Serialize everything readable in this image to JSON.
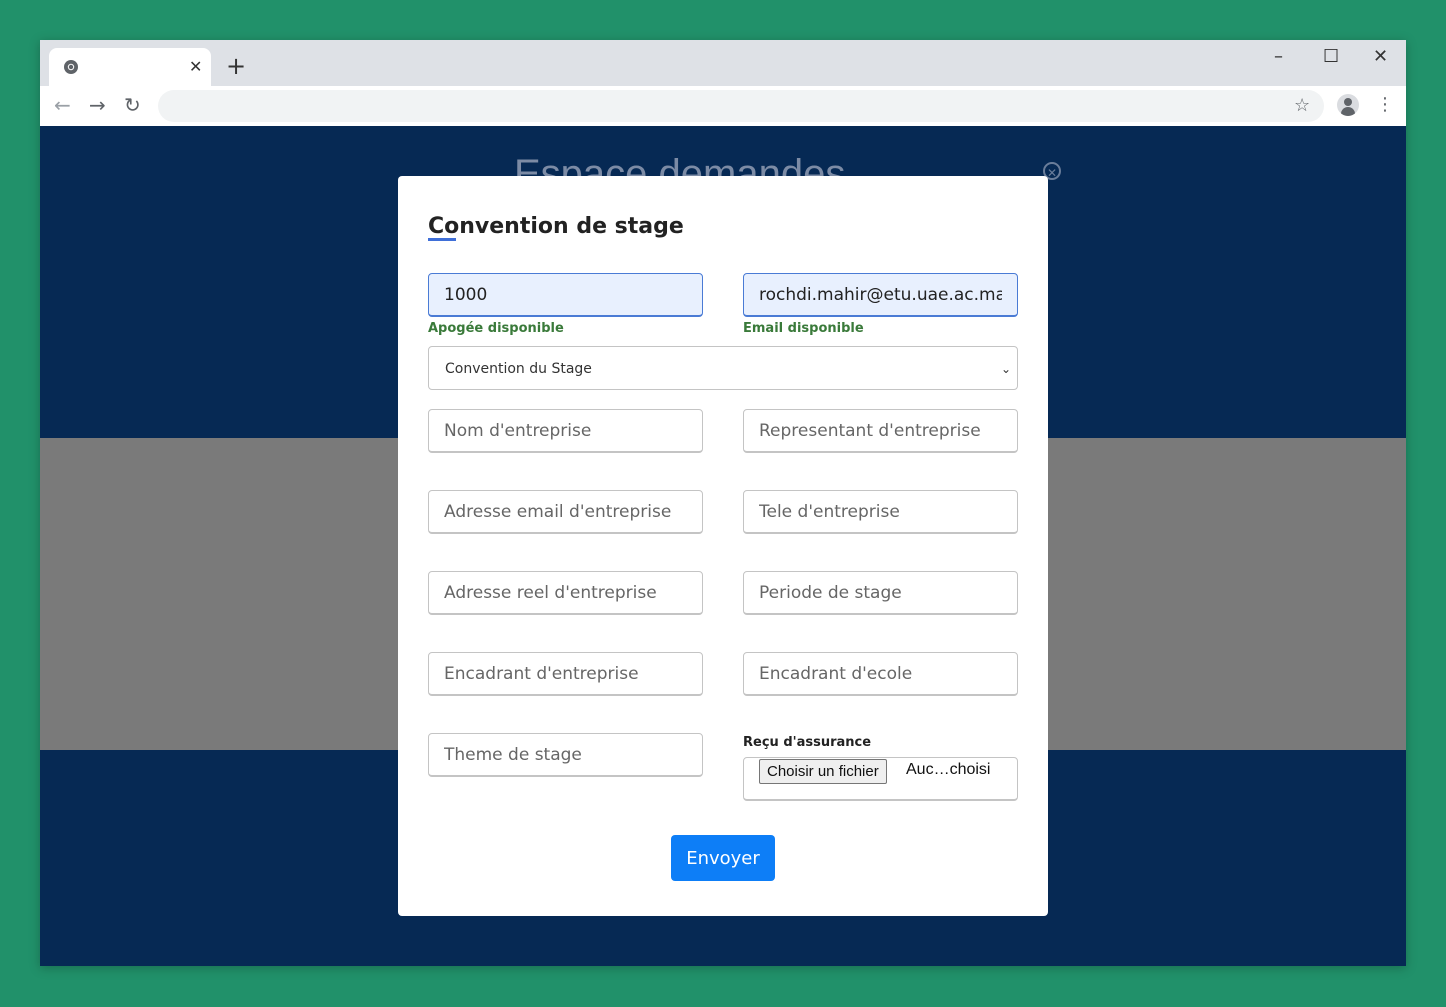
{
  "browser": {
    "tab_close": "✕",
    "new_tab": "+",
    "min": "–",
    "max": "☐",
    "close": "✕",
    "back": "←",
    "forward": "→",
    "reload": "↻",
    "star": "☆",
    "menu": "⋮"
  },
  "page": {
    "background_title": "Espace demandes",
    "background_close": "✕"
  },
  "modal": {
    "title": "Convention de stage",
    "apogee": {
      "value": "1000",
      "hint": "Apogée disponible"
    },
    "email": {
      "value": "rochdi.mahir@etu.uae.ac.ma",
      "hint": "Email disponible"
    },
    "select": {
      "selected": "Convention du Stage",
      "chevron": "⌄"
    },
    "fields": {
      "nom_entreprise": "Nom d'entreprise",
      "representant": "Representant d'entreprise",
      "email_entreprise": "Adresse email d'entreprise",
      "tele_entreprise": "Tele d'entreprise",
      "adresse_reel": "Adresse reel d'entreprise",
      "periode": "Periode de stage",
      "encadrant_entreprise": "Encadrant d'entreprise",
      "encadrant_ecole": "Encadrant d'ecole",
      "theme": "Theme de stage"
    },
    "file": {
      "label": "Reçu d'assurance",
      "button": "Choisir un fichier",
      "status": "Auc…choisi"
    },
    "submit": "Envoyer"
  },
  "colors": {
    "desktop": "#21916a",
    "page_bg": "#062954",
    "gray_band": "#7a7a7a",
    "accent": "#0d7ef7",
    "hint_green": "#3a7a3a"
  }
}
